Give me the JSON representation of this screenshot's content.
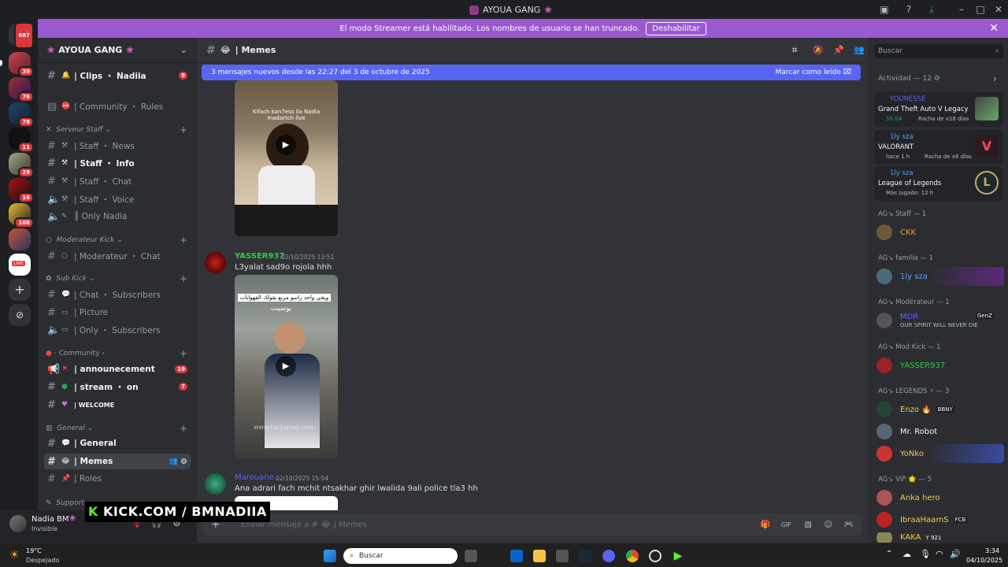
{
  "window": {
    "title": "AYOUA GANG"
  },
  "banner": {
    "text": "El modo Streamer está habilitado. Los nombres de usuario se han truncado.",
    "button": "Deshabilitar"
  },
  "rail": {
    "badges": [
      "687",
      "39",
      "76",
      "78",
      "11",
      "29",
      "16",
      "108"
    ],
    "live_label": "LIVE"
  },
  "guild": {
    "name": "AYOUA GANG"
  },
  "channels": {
    "clips": {
      "label": "| Clips ・ Nadiia",
      "badge": "9"
    },
    "rules": "| Community ・ Rules",
    "cat_staff": "Serveur Staff",
    "staff_news": "| Staff ・ News",
    "staff_info": "| Staff ・ Info",
    "staff_chat": "| Staff ・ Chat",
    "staff_voice": "| Staff ・ Voice",
    "only_nadia": "║ Only Nadia",
    "cat_mod": "Moderateur Kick",
    "mod_chat": "| Moderateur ・ Chat",
    "cat_sub": "Sub Kick",
    "chat_subs": "| Chat ・ Subscribers",
    "picture": "| Picture",
    "only_subs": "| Only ・ Subscribers",
    "cat_community": "Community",
    "announcement": {
      "label": "| announecement",
      "badge": "19"
    },
    "stream": {
      "label": "| stream ・ on",
      "badge": "7"
    },
    "welcome": "| WELCOME",
    "cat_general": "General",
    "general": "| General",
    "memes": "| Memes",
    "roles": "| Roles",
    "cat_support": "Support"
  },
  "user": {
    "name": "Nadia BM",
    "status": "Invisible"
  },
  "overlay": {
    "kick": "KICK.COM / BMNADIIA"
  },
  "chat": {
    "channel_name": "| Memes",
    "new_messages": "3 mensajes nuevos desde las 22:27 del 3 de octubre de 2025",
    "mark_read": "Marcar como leído",
    "video1_caption": "Kifach kan7ess ila Nadia madartch live",
    "msg1": {
      "author": "YASSER937",
      "time": "02/10/2025 13:51",
      "text": "L3yalat sad9o rojola hhh",
      "video_caption": "ويجي واحد راسو مربع يقولك القهوايات",
      "video_sub": "بوسيت",
      "watermark": "www.tanjaplay.com"
    },
    "msg2": {
      "author": "Marouane",
      "time": "02/10/2025 15:54",
      "text": "Ana adrari fach mchit ntsakhar ghir lwalida 9ali police tla3 hh"
    },
    "composer_placeholder": "Enviar mensaje a #",
    "composer_channel": "| Memes"
  },
  "members": {
    "search_placeholder": "Buscar",
    "activity_header": "Actividad — 12",
    "activities": [
      {
        "user": "YOUNESSE",
        "game": "Grand Theft Auto V Legacy",
        "detail": "55:04",
        "detail2": "Racha de x18 días"
      },
      {
        "user": "1ly sza",
        "game": "VALORANT",
        "detail": "hace 1 h",
        "detail2": "Racha de x8 días"
      },
      {
        "user": "1ly sza",
        "game": "League of Legends",
        "detail": "Más jugado: 12 h"
      }
    ],
    "sections": [
      "AG↘ Staff — 1",
      "AG↘ familia — 1",
      "AG↘ Modérateur — 1",
      "AG↘ Mod Kick — 1",
      "AG↘ LEGENDS ⚡ — 3",
      "AG↘ VIP 🌟 — 5"
    ],
    "list": [
      {
        "name": "CKK",
        "color": "#f0a030"
      },
      {
        "name": "1ly sza",
        "color": "#5b9cf5"
      },
      {
        "name": "MDR",
        "color": "#5865f2",
        "tag": "GenZ",
        "sub": "OUR SPIRIT WILL NEVER DIE"
      },
      {
        "name": "YASSER937",
        "color": "#2ecc40"
      },
      {
        "name": "Enzo",
        "color": "#f2c94c",
        "tag": "BBNY"
      },
      {
        "name": "Mr. Robot",
        "color": "#f2f3f5"
      },
      {
        "name": "YoNko",
        "color": "#f2c94c"
      },
      {
        "name": "Anka hero",
        "color": "#f2c94c"
      },
      {
        "name": "IbraaHaamS",
        "color": "#f2c94c",
        "tag": "FCB"
      },
      {
        "name": "KAKA",
        "color": "#f2c94c",
        "tag": "Y 921"
      }
    ]
  },
  "taskbar": {
    "weather_temp": "19°C",
    "weather_desc": "Despejado",
    "search": "Buscar",
    "time": "3:34",
    "date": "04/10/2025"
  }
}
